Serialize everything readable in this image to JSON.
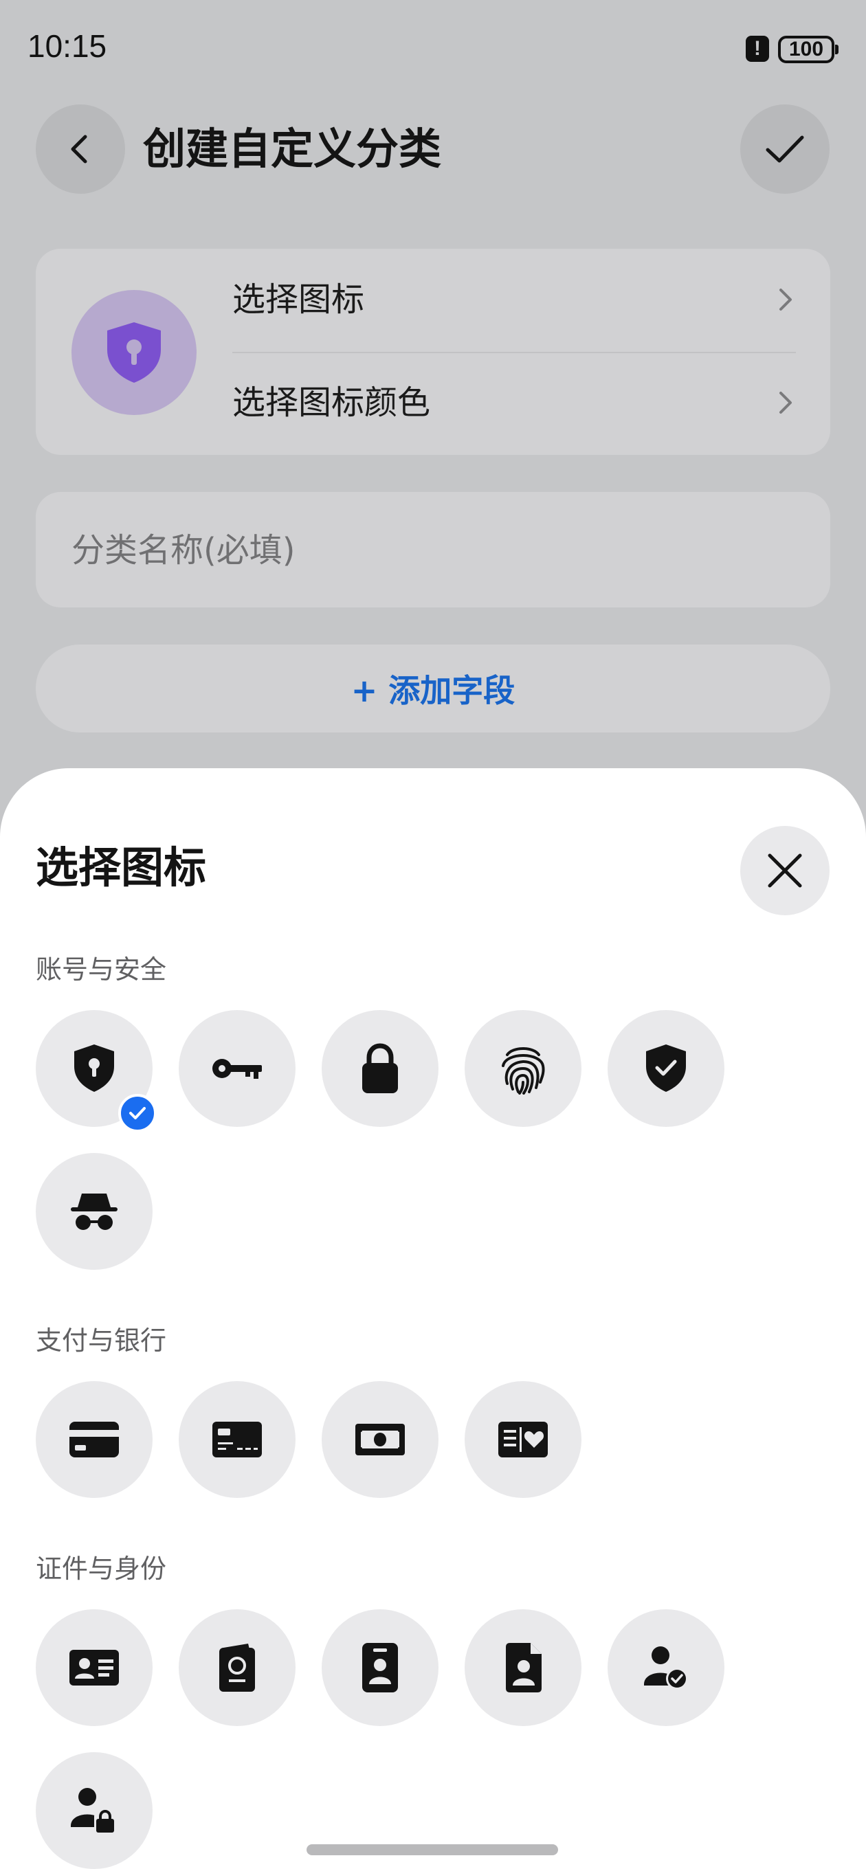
{
  "status_bar": {
    "time": "10:15",
    "battery": "100"
  },
  "header": {
    "title": "创建自定义分类"
  },
  "icon_settings": {
    "choose_icon_label": "选择图标",
    "choose_color_label": "选择图标颜色",
    "preview_color": "#7a50cf",
    "preview_bg": "#b6a9ce"
  },
  "name_field": {
    "placeholder": "分类名称(必填)",
    "value": ""
  },
  "add_field_label": "+ 添加字段",
  "sheet": {
    "title": "选择图标",
    "sections": [
      {
        "label": "账号与安全",
        "icons": [
          "shield-keyhole-icon",
          "key-icon",
          "lock-icon",
          "fingerprint-icon",
          "shield-check-icon",
          "incognito-icon"
        ],
        "selected_index": 0
      },
      {
        "label": "支付与银行",
        "icons": [
          "credit-card-icon",
          "bank-card-icon",
          "banknote-icon",
          "card-heart-icon"
        ]
      },
      {
        "label": "证件与身份",
        "icons": [
          "id-card-icon",
          "passport-icon",
          "badge-icon",
          "id-document-icon",
          "user-check-icon",
          "user-lock-icon"
        ]
      }
    ]
  },
  "colors": {
    "accent": "#1a6df0",
    "link": "#1863c8"
  }
}
